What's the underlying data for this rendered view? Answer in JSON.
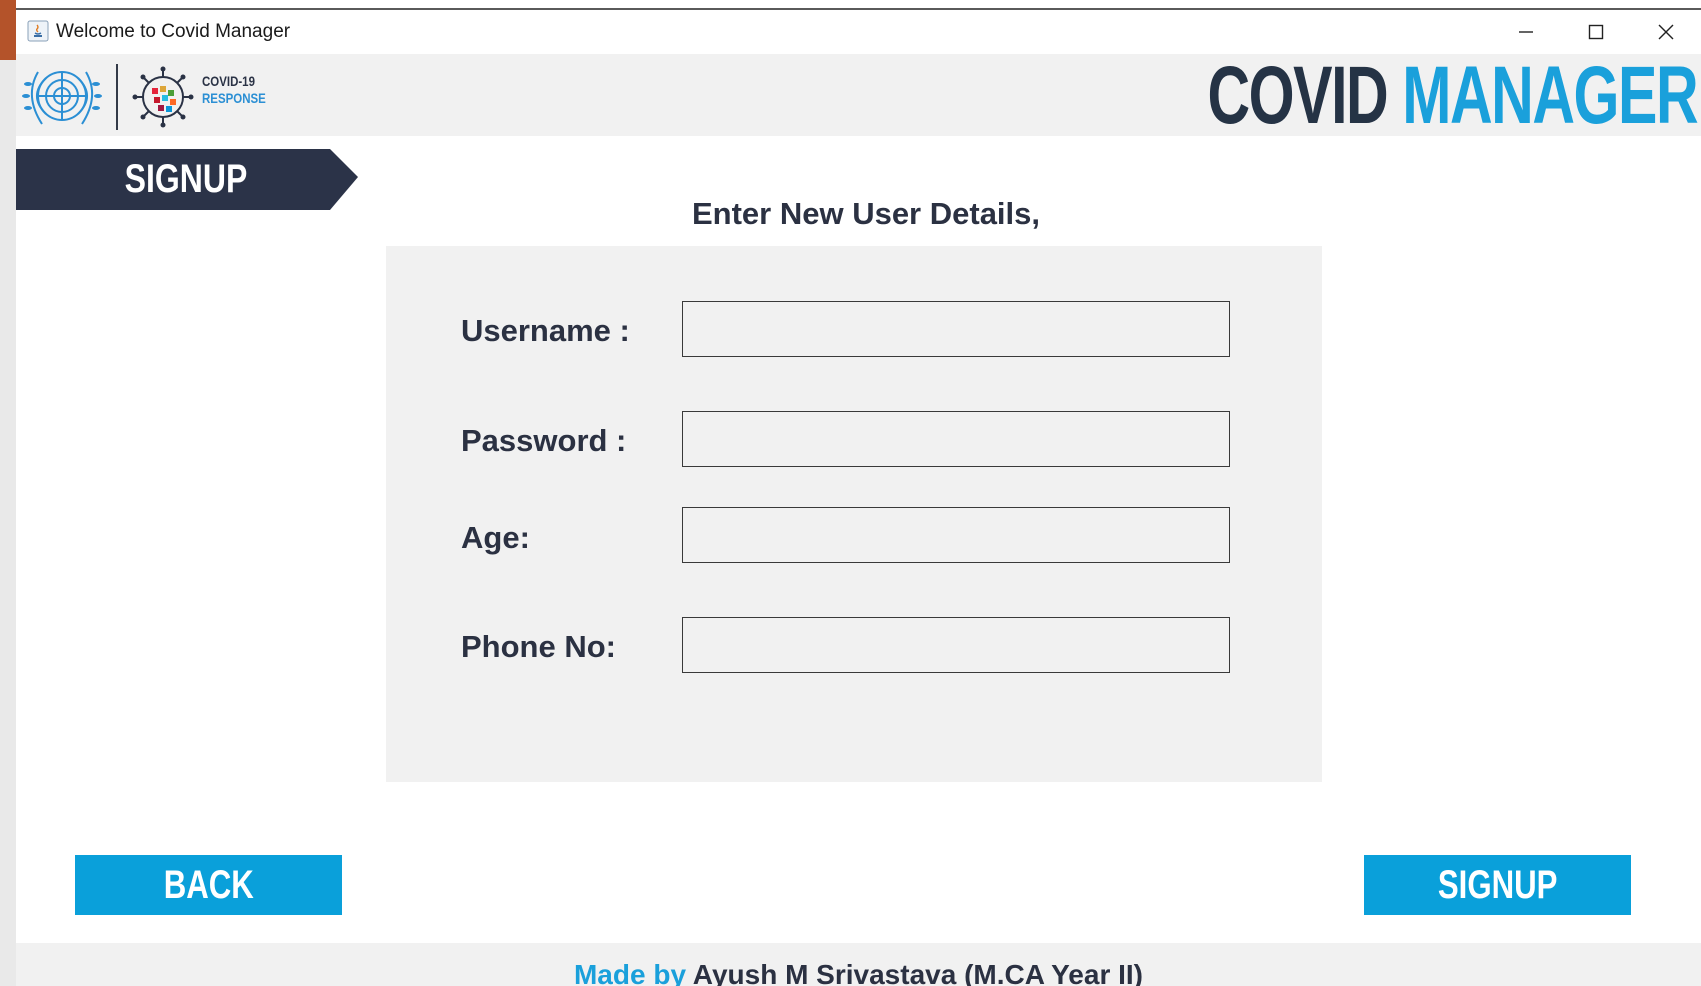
{
  "window": {
    "title": "Welcome to Covid Manager"
  },
  "header": {
    "logo_line1": "COVID-19",
    "logo_line2": "RESPONSE",
    "brand_word1": "COVID",
    "brand_word2": "MANAGER",
    "brand_dark_color": "#253345",
    "brand_accent_color": "#1aa0db"
  },
  "section": {
    "label": "SIGNUP"
  },
  "form": {
    "heading": "Enter New User Details,",
    "fields": [
      {
        "label": "Username :",
        "value": ""
      },
      {
        "label": "Password :",
        "value": ""
      },
      {
        "label": "Age:",
        "value": ""
      },
      {
        "label": "Phone No:",
        "value": ""
      }
    ]
  },
  "actions": {
    "back_label": "BACK",
    "signup_label": "SIGNUP",
    "button_color": "#0aa0da"
  },
  "footer": {
    "prefix": "Made by",
    "author": "Ayush M Srivastava (M.CA Year II)"
  },
  "icons": {
    "app": "java-app-icon",
    "minimize": "minimize-icon",
    "maximize": "maximize-icon",
    "close": "close-icon",
    "un": "un-emblem-logo",
    "covid": "covid-virus-logo"
  }
}
